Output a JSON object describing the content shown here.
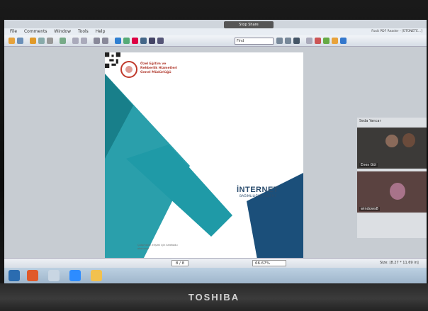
{
  "device": {
    "brand": "TOSHIBA"
  },
  "share_banner": "Stop Share",
  "menu": [
    "File",
    "Comments",
    "Window",
    "Tools",
    "Help"
  ],
  "app_title": "Foxit PDF Reader - [ÜTÜNETE...]",
  "toolbar": {
    "find_placeholder": "Find"
  },
  "document": {
    "org_lines": [
      "Özel Eğitim ve",
      "Rehberlik Hizmetleri",
      "Genel Müdürlüğü"
    ],
    "title": "İNTERNET",
    "subtitle": "BAĞIMLILIĞINI ÖNLEME",
    "qr_text": "Çalışmanın erişimi için karekodu okutunuz"
  },
  "participants": {
    "top_name": "Seda Yancar",
    "videos": [
      {
        "label": "Enes Gül"
      },
      {
        "label": "windows8"
      }
    ]
  },
  "status": {
    "page": "8 / 8",
    "zoom": "66.67%",
    "size": "Size: [8.27 * 11.69 in]"
  },
  "colors": {
    "teal": "#1f9aa7",
    "navy": "#1b4f7a",
    "accent": "#c0392b"
  }
}
